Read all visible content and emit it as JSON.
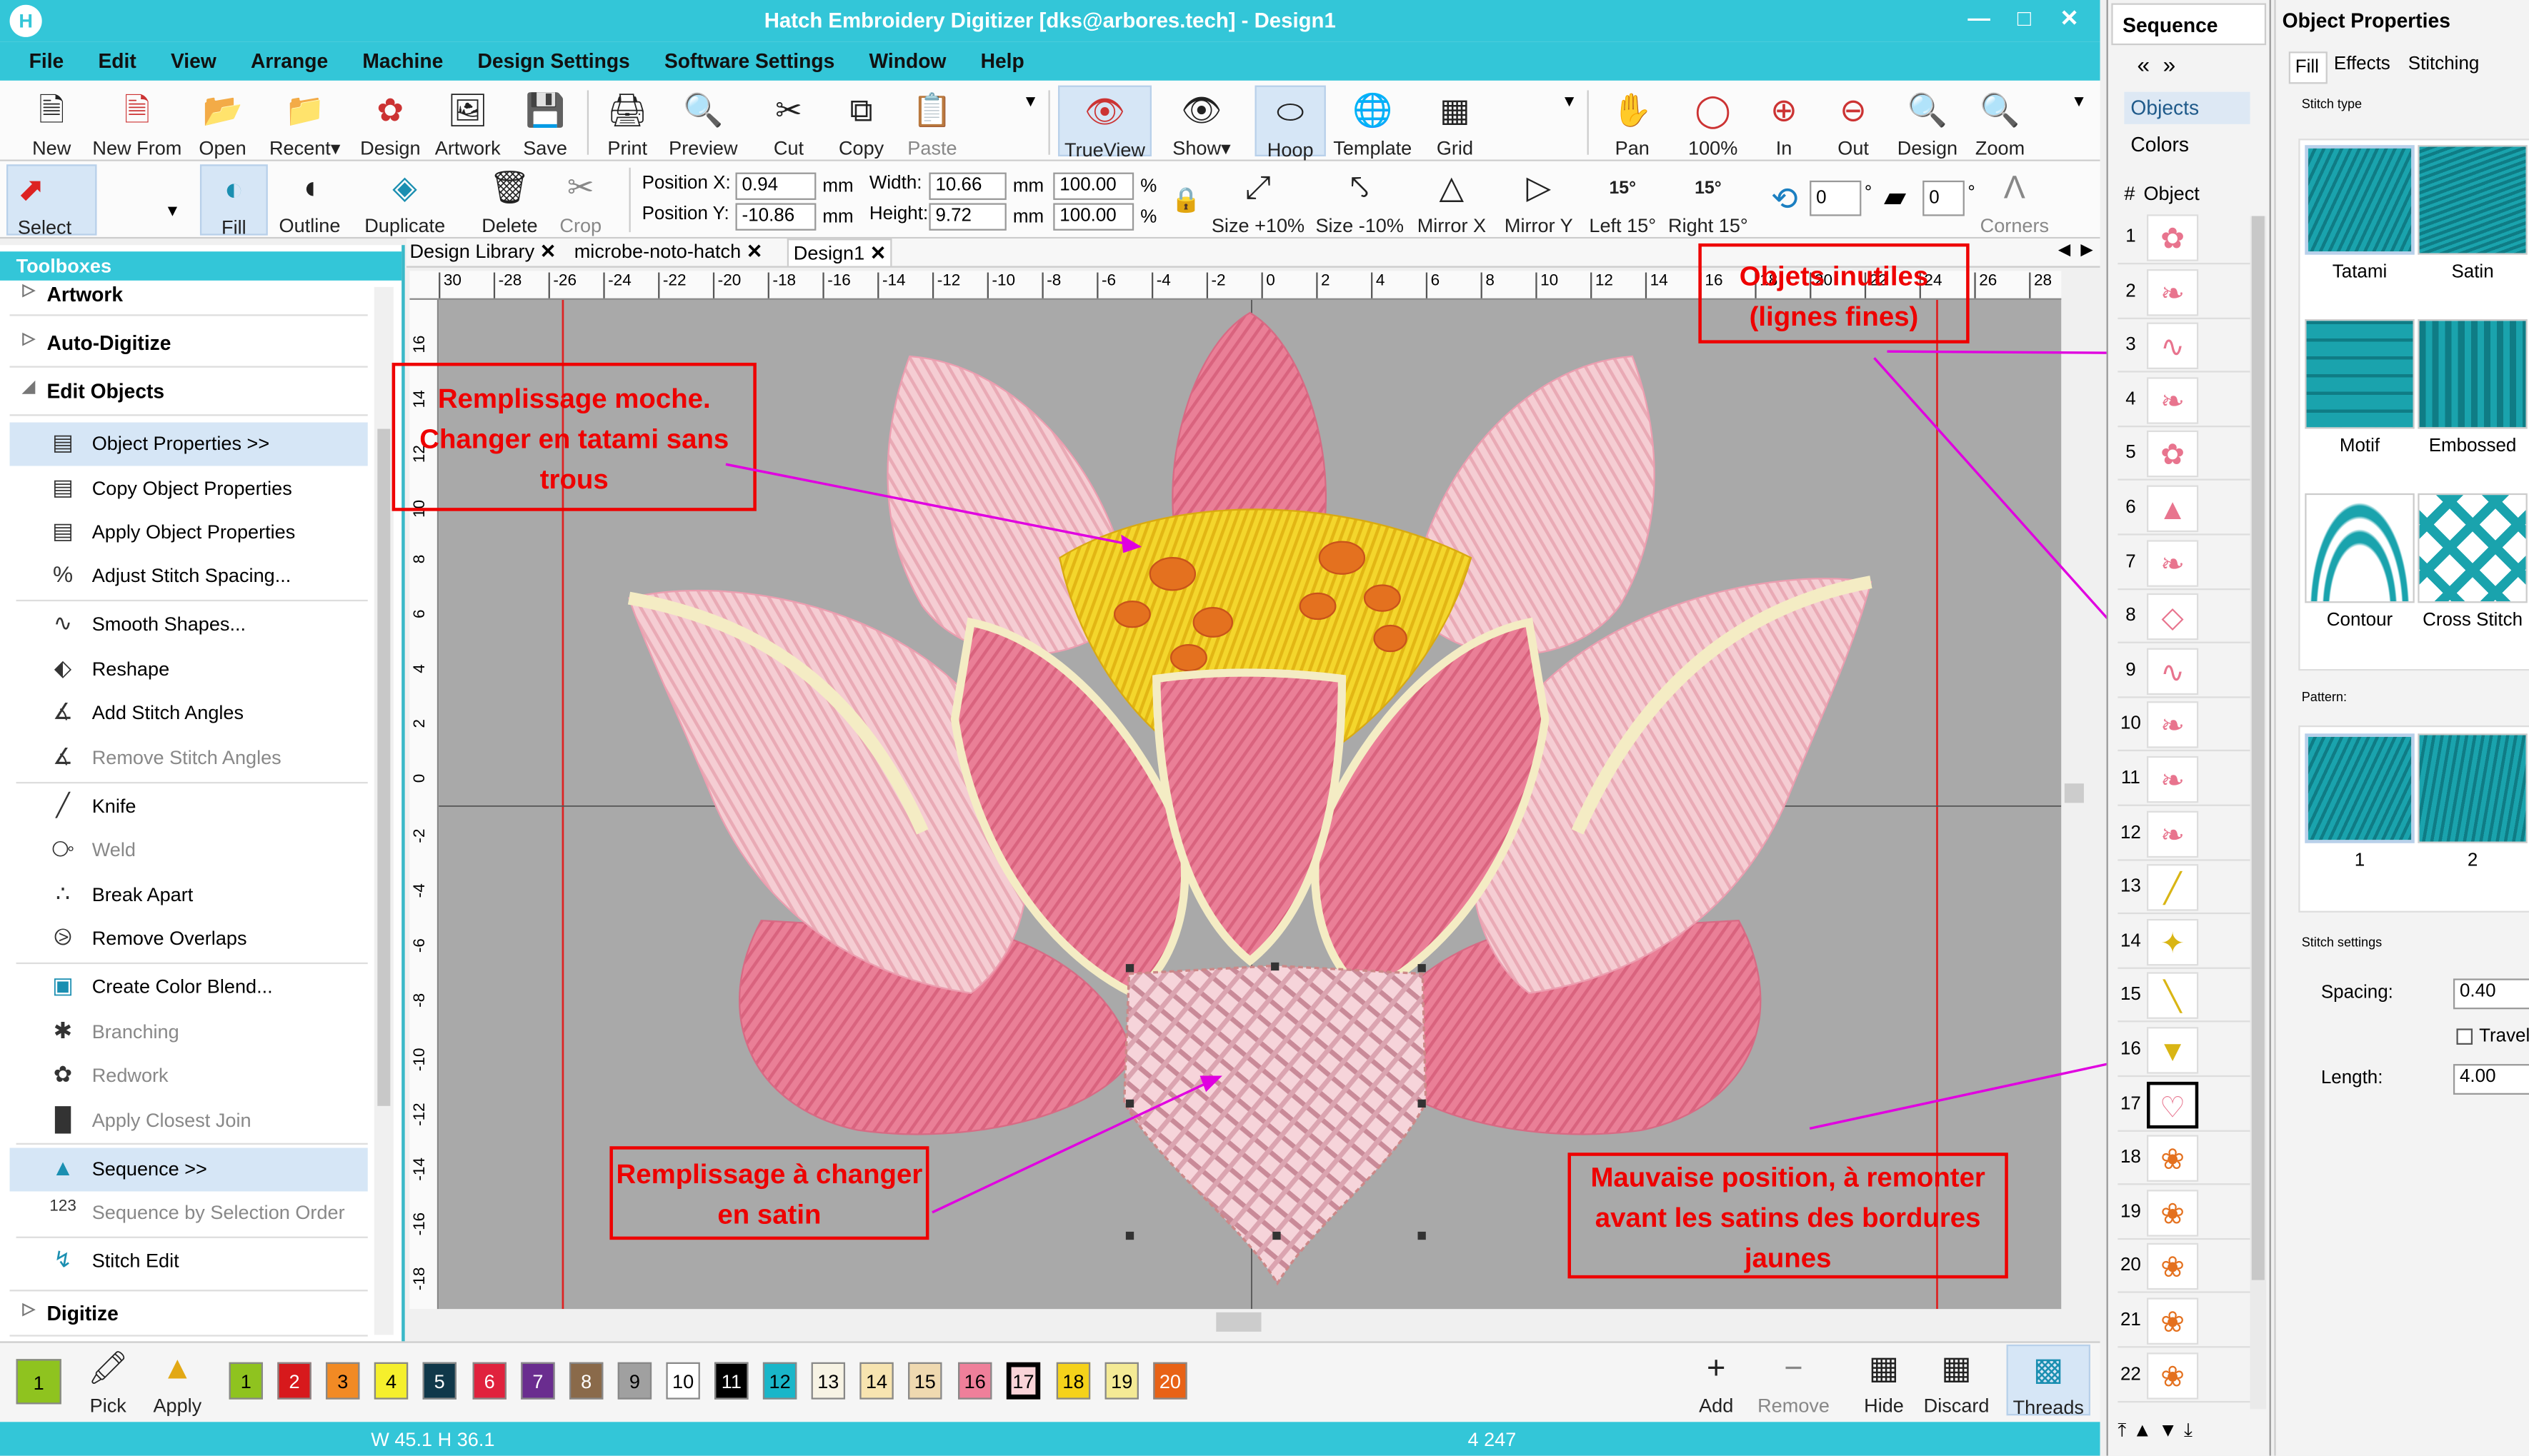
{
  "app": {
    "title": "Hatch Embroidery Digitizer [dks@arbores.tech] - Design1",
    "logo_letter": "H",
    "window_controls": [
      "—",
      "□",
      "✕"
    ]
  },
  "menu": [
    "File",
    "Edit",
    "View",
    "Arrange",
    "Machine",
    "Design Settings",
    "Software Settings",
    "Window",
    "Help"
  ],
  "toolbar1": {
    "new": "New",
    "new_from": "New From",
    "open": "Open",
    "recent": "Recent",
    "design": "Design",
    "artwork": "Artwork",
    "save": "Save",
    "print": "Print",
    "preview": "Preview",
    "cut": "Cut",
    "copy": "Copy",
    "paste": "Paste",
    "trueview": "TrueView",
    "show": "Show",
    "hoop": "Hoop",
    "template": "Template",
    "grid": "Grid",
    "pan": "Pan",
    "zoom100": "100%",
    "zin": "In",
    "zout": "Out",
    "zdesign": "Design",
    "zoom": "Zoom"
  },
  "toolbar2": {
    "select": "Select",
    "fill": "Fill",
    "outline": "Outline",
    "duplicate": "Duplicate",
    "delete": "Delete",
    "crop": "Crop",
    "pos_x_label": "Position X:",
    "pos_x": "0.94",
    "pos_y_label": "Position Y:",
    "pos_y": "-10.86",
    "width_label": "Width:",
    "width": "10.66",
    "height_label": "Height:",
    "height": "9.72",
    "unit": "mm",
    "pct_w": "100.00",
    "pct_h": "100.00",
    "pct": "%",
    "size_up": "Size +10%",
    "size_down": "Size -10%",
    "mirror_x": "Mirror X",
    "mirror_y": "Mirror Y",
    "left15": "Left 15°",
    "right15": "Right 15°",
    "rot_value": "0",
    "slant_value": "0",
    "degree": "°",
    "corners": "Corners",
    "deg15": "15°"
  },
  "toolboxes": {
    "title": "Toolboxes",
    "categories": {
      "artwork": "Artwork",
      "auto": "Auto-Digitize",
      "edit": "Edit Objects",
      "digitize": "Digitize"
    },
    "items": [
      "Object Properties >>",
      "Copy Object Properties",
      "Apply Object Properties",
      "Adjust Stitch Spacing...",
      "Smooth Shapes...",
      "Reshape",
      "Add Stitch Angles",
      "Remove Stitch Angles",
      "Knife",
      "Weld",
      "Break Apart",
      "Remove Overlaps",
      "Create Color Blend...",
      "Branching",
      "Redwork",
      "Apply Closest Join",
      "Sequence >>",
      "Sequence by Selection Order",
      "Stitch Edit"
    ]
  },
  "doc_tabs": [
    "Design Library",
    "microbe-noto-hatch",
    "Design1"
  ],
  "ruler_h": [
    "30",
    "-28",
    "-26",
    "-24",
    "-22",
    "-20",
    "-18",
    "-16",
    "-14",
    "-12",
    "-10",
    "-8",
    "-6",
    "-4",
    "-2",
    "0",
    "2",
    "4",
    "6",
    "8",
    "10",
    "12",
    "14",
    "16",
    "18",
    "20",
    "22",
    "24",
    "26",
    "28"
  ],
  "ruler_v": [
    "16",
    "14",
    "12",
    "10",
    "8",
    "6",
    "4",
    "2",
    "0",
    "-2",
    "-4",
    "-6",
    "-8",
    "-10",
    "-12",
    "-14",
    "-16",
    "-18"
  ],
  "annotations": {
    "a1": "Remplissage moche. Changer en tatami sans trous",
    "a2": "Objets inutiles (lignes fines)",
    "a3": "Remplissage à changer en satin",
    "a4": "Mauvaise position, à remonter avant les satins des bordures jaunes"
  },
  "colors": {
    "accent": "#33c6d8",
    "annotation": "#e00000",
    "arrow": "#e000e0",
    "canvas": "#a9a9a9",
    "petal_pink": "#e8748e",
    "petal_light": "#f6c9cf",
    "yellow": "#f3d41c",
    "orange": "#e46a1e",
    "cream": "#f4ecc4"
  },
  "sequence": {
    "title": "Sequence",
    "tabs": [
      "Objects",
      "Colors"
    ],
    "col_hash": "#",
    "col_object": "Object",
    "rows": [
      "1",
      "2",
      "3",
      "4",
      "5",
      "6",
      "7",
      "8",
      "9",
      "10",
      "11",
      "12",
      "13",
      "14",
      "15",
      "16",
      "17",
      "18",
      "19",
      "20",
      "21",
      "22"
    ]
  },
  "object_properties": {
    "title": "Object Properties",
    "tabs": [
      "Fill",
      "Effects",
      "Stitching"
    ],
    "stitch_type_label": "Stitch type",
    "stitch_types": [
      "Tatami",
      "Satin",
      "Motif",
      "Embossed",
      "Contour",
      "Cross Stitch"
    ],
    "pattern_label": "Pattern:",
    "patterns": [
      "1",
      "2"
    ],
    "stitch_settings_label": "Stitch settings",
    "spacing_label": "Spacing:",
    "spacing": "0.40",
    "travel_label": "Travel",
    "length_label": "Length:",
    "length": "4.00"
  },
  "palette": {
    "current": "1",
    "pick": "Pick",
    "apply": "Apply",
    "swatches": [
      {
        "n": "1",
        "c": "#8fc31f"
      },
      {
        "n": "2",
        "c": "#d7191c"
      },
      {
        "n": "3",
        "c": "#f28a24"
      },
      {
        "n": "4",
        "c": "#f5ef2c"
      },
      {
        "n": "5",
        "c": "#10384a"
      },
      {
        "n": "6",
        "c": "#e0223d"
      },
      {
        "n": "7",
        "c": "#6a2d8f"
      },
      {
        "n": "8",
        "c": "#8a6a4a"
      },
      {
        "n": "9",
        "c": "#a0a0a0"
      },
      {
        "n": "10",
        "c": "#ffffff"
      },
      {
        "n": "11",
        "c": "#000000"
      },
      {
        "n": "12",
        "c": "#19b6c9"
      },
      {
        "n": "13",
        "c": "#f7f3e4"
      },
      {
        "n": "14",
        "c": "#f7e4b0"
      },
      {
        "n": "15",
        "c": "#efd9b0"
      },
      {
        "n": "16",
        "c": "#ef7f9a"
      },
      {
        "n": "17",
        "c": "#f9d3d8"
      },
      {
        "n": "18",
        "c": "#f5d21a"
      },
      {
        "n": "19",
        "c": "#f4ea95"
      },
      {
        "n": "20",
        "c": "#e86216"
      }
    ],
    "add": "Add",
    "remove": "Remove",
    "hide": "Hide",
    "discard": "Discard",
    "threads": "Threads"
  },
  "status": {
    "size": "W  45.1  H  36.1",
    "stitches": "4 247"
  }
}
